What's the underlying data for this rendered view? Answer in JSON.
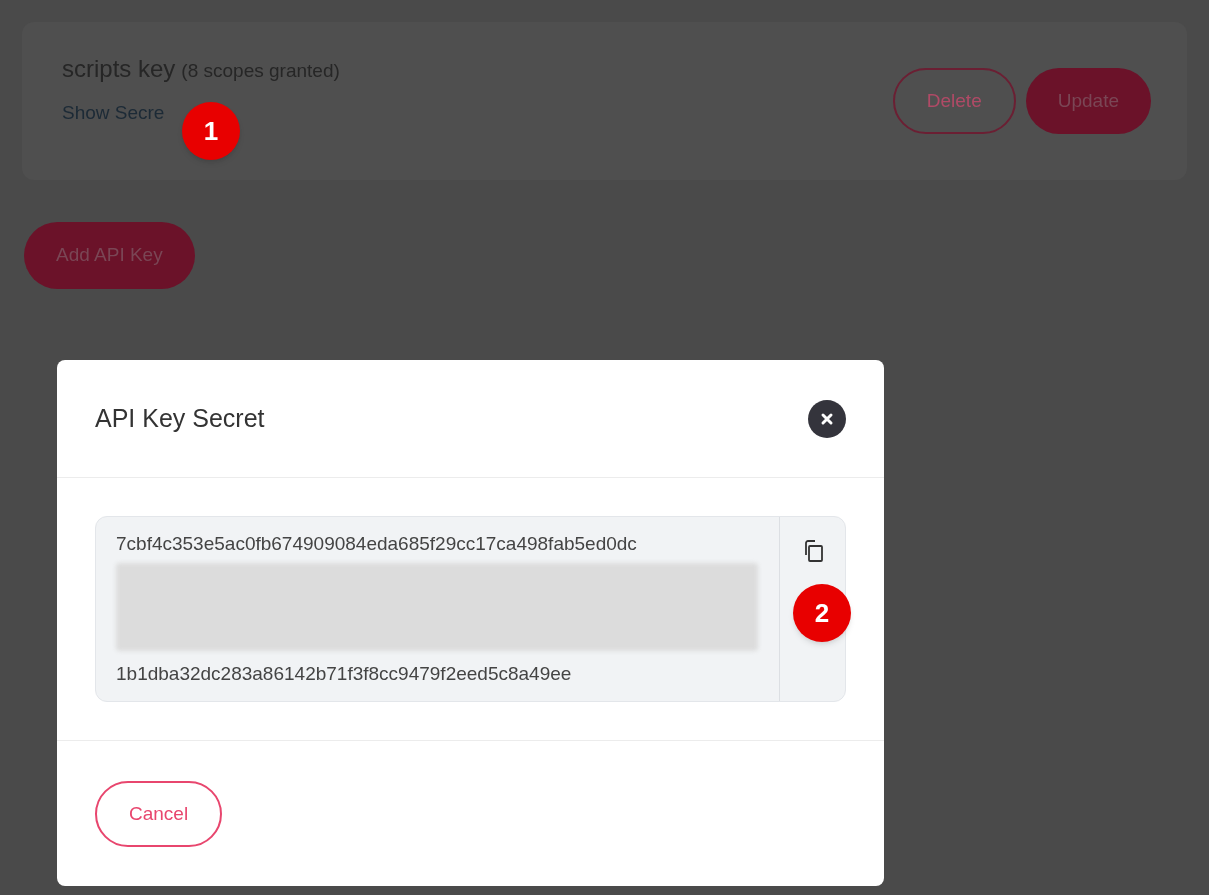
{
  "key_card": {
    "name": "scripts key",
    "scopes": "(8 scopes granted)",
    "link": "Show Secre",
    "buttons": [
      {
        "label": "Delete",
        "kind": "outline"
      },
      {
        "label": "Update",
        "kind": "filled"
      }
    ]
  },
  "add_button": "Add API Key",
  "modal": {
    "title": "API Key Secret",
    "secret_lines": [
      "7cbf4c353e5ac0fb674909084eda685f29cc17ca498fab5ed0dc",
      "1b1dba32dc283a86142b71f3f8cc9479f2eed5c8a49ee"
    ],
    "redacted": true,
    "cancel": "Cancel"
  },
  "callouts": [
    "1",
    "2"
  ]
}
